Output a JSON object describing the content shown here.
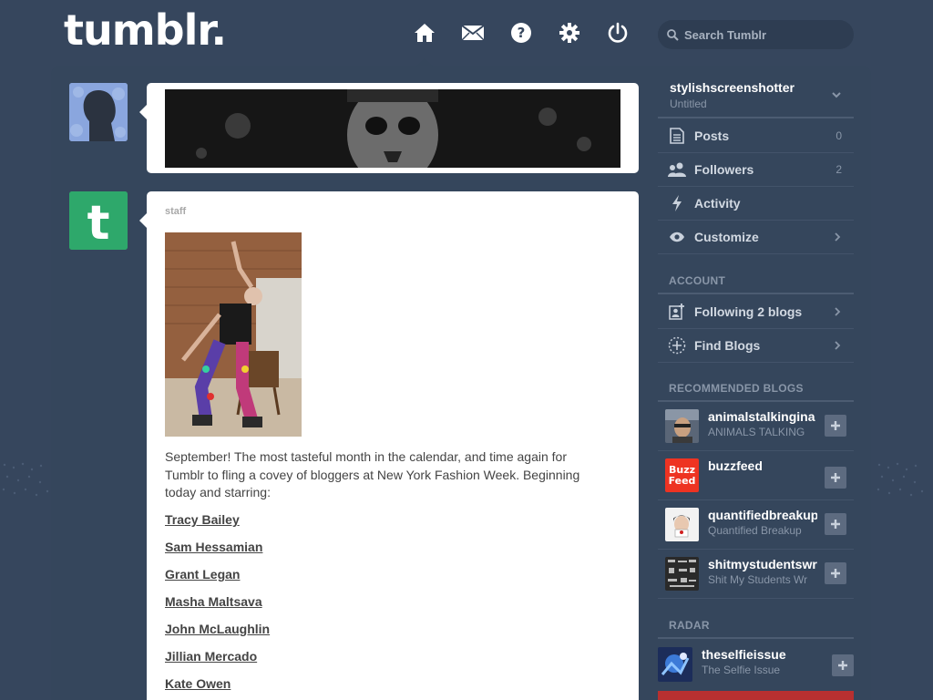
{
  "header": {
    "logo": "tumblr.",
    "search_placeholder": "Search Tumblr"
  },
  "nav": [
    {
      "name": "home-icon"
    },
    {
      "name": "mail-icon"
    },
    {
      "name": "help-icon"
    },
    {
      "name": "settings-icon"
    },
    {
      "name": "logout-icon"
    }
  ],
  "posts": {
    "post2": {
      "author": "staff",
      "text": "September! The most tasteful month in the calendar, and time again for Tumblr to fling a covey of bloggers at New York Fashion Week. Beginning today and starring:",
      "links": [
        "Tracy Bailey",
        "Sam Hessamian",
        "Grant Legan",
        "Masha Maltsava",
        "John McLaughlin",
        "Jillian Mercado",
        "Kate Owen"
      ]
    }
  },
  "sidebar": {
    "blog": {
      "name": "stylishscreenshotter",
      "title": "Untitled"
    },
    "items": [
      {
        "label": "Posts",
        "count": "0",
        "icon": "posts-icon"
      },
      {
        "label": "Followers",
        "count": "2",
        "icon": "followers-icon"
      },
      {
        "label": "Activity",
        "count": "",
        "icon": "activity-icon"
      },
      {
        "label": "Customize",
        "count": "",
        "icon": "eye-icon"
      }
    ],
    "account_heading": "ACCOUNT",
    "account_items": [
      {
        "label": "Following 2 blogs",
        "icon": "following-icon"
      },
      {
        "label": "Find Blogs",
        "icon": "find-blogs-icon"
      }
    ],
    "recommended_heading": "RECOMMENDED BLOGS",
    "recommended": [
      {
        "name": "animalstalkingina",
        "title": "ANIMALS TALKING"
      },
      {
        "name": "buzzfeed",
        "title": "",
        "thumb_label": "Buzz Feed"
      },
      {
        "name": "quantifiedbreakup",
        "title": "Quantified Breakup"
      },
      {
        "name": "shitmystudentswr",
        "title": "Shit My Students Wr"
      }
    ],
    "radar_heading": "RADAR",
    "radar": {
      "name": "theselfieissue",
      "title": "The Selfie Issue"
    }
  },
  "colors": {
    "background": "#36465d",
    "accent_green": "#2ea86b",
    "panel": "#35465c"
  }
}
